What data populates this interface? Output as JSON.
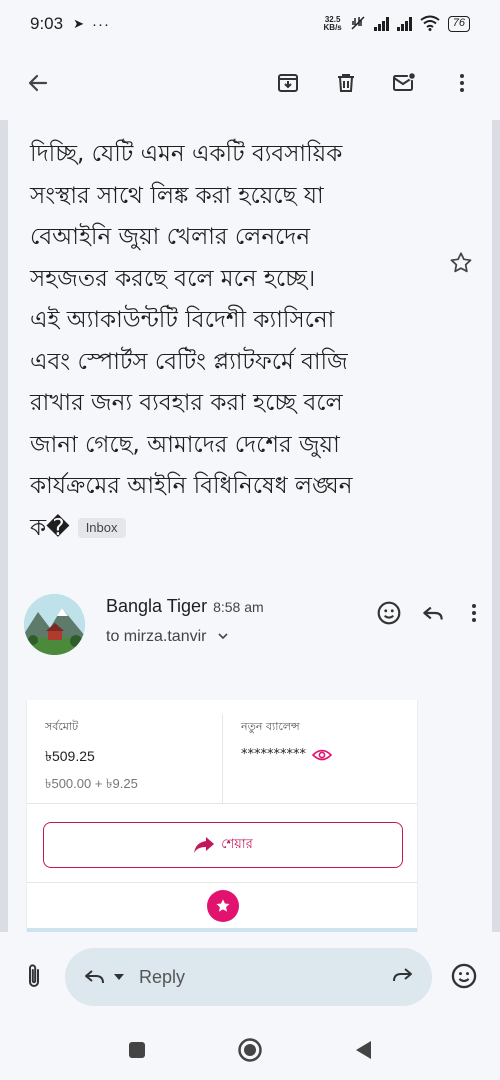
{
  "status_bar": {
    "time": "9:03",
    "net_speed_value": "32.5",
    "net_speed_unit": "KB/s",
    "battery": "76"
  },
  "email": {
    "body_lines": [
      "দিচ্ছি, যেটি এমন একটি ব্যবসায়িক",
      "সংস্থার সাথে লিঙ্ক করা হয়েছে যা",
      "বেআইনি জুয়া খেলার লেনদেন",
      "সহজতর করছে বলে মনে হচ্ছে।",
      "এই অ্যাকাউন্টটি বিদেশী ক্যাসিনো",
      "এবং স্পোর্টস বেটিং প্ল্যাটফর্মে বাজি",
      "রাখার জন্য ব্যবহার করা হচ্ছে বলে",
      "জানা গেছে, আমাদের দেশের জুয়া",
      "কার্যক্রমের আইনি বিধিনিষেধ লঙ্ঘন"
    ],
    "last_line": "ক�",
    "label_chip": "Inbox"
  },
  "sender": {
    "name": "Bangla Tiger",
    "time": "8:58 am",
    "to": "to mirza.tanvir"
  },
  "receipt": {
    "total_label": "সর্বমোট",
    "total_amount": "৳509.25",
    "breakdown": "৳500.00 + ৳9.25",
    "new_balance_label": "নতুন ব্যালেন্স",
    "masked_balance": "**********",
    "share_label": "শেয়ার"
  },
  "reply_bar": {
    "reply_label": "Reply"
  },
  "colors": {
    "brand_pink": "#e2136e",
    "share_border": "#c2185b",
    "reply_bg": "#dce7ee"
  }
}
